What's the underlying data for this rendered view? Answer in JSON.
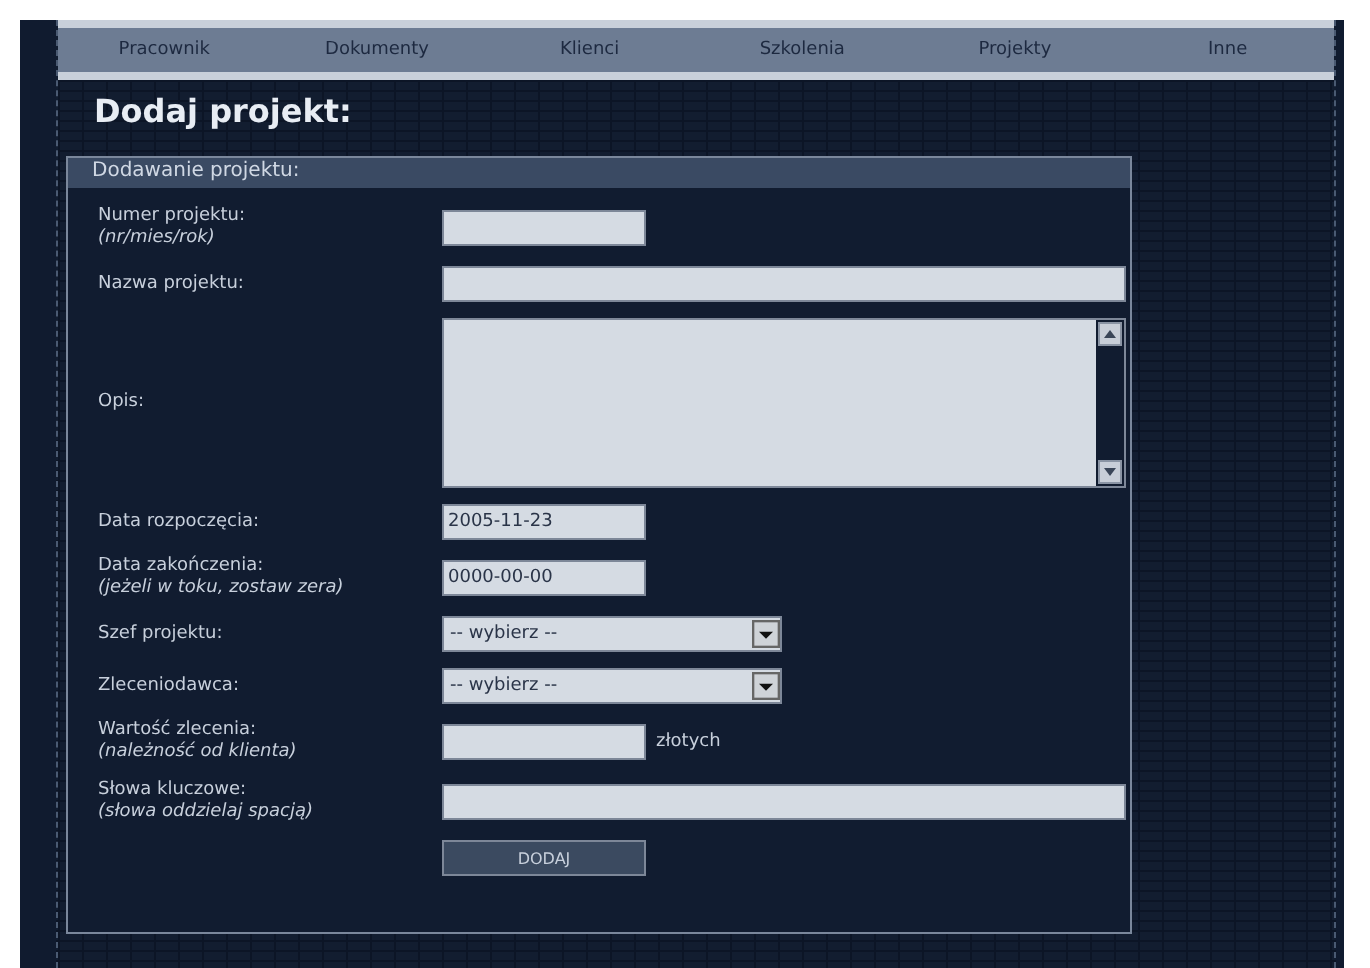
{
  "nav": [
    {
      "label": "Pracownik"
    },
    {
      "label": "Dokumenty"
    },
    {
      "label": "Klienci"
    },
    {
      "label": "Szkolenia"
    },
    {
      "label": "Projekty"
    },
    {
      "label": "Inne"
    }
  ],
  "title": "Dodaj projekt:",
  "panel": {
    "header": "Dodawanie projektu:",
    "fields": [
      {
        "kind": "text",
        "label": "Numer projektu:",
        "hint": "(nr/mies/rok)"
      },
      {
        "kind": "wide",
        "label": "Nazwa projektu:"
      },
      {
        "kind": "textarea",
        "label": "Opis:"
      },
      {
        "kind": "text",
        "label": "Data rozpoczęcia:",
        "value": "2005-11-23"
      },
      {
        "kind": "text",
        "label": "Data zakończenia:",
        "hint": "(jeżeli w toku, zostaw zera)",
        "value": "0000-00-00"
      },
      {
        "kind": "select",
        "label": "Szef projektu:",
        "value": "-- wybierz --"
      },
      {
        "kind": "select",
        "label": "Zleceniodawca:",
        "value": "-- wybierz --"
      },
      {
        "kind": "text",
        "label": "Wartość zlecenia:",
        "hint": "(należność od klienta)",
        "suffix": "złotych"
      },
      {
        "kind": "wide",
        "label": "Słowa kluczowe:",
        "hint": "(słowa oddzielaj spacją)"
      },
      {
        "kind": "button",
        "label": "DODAJ"
      }
    ]
  }
}
